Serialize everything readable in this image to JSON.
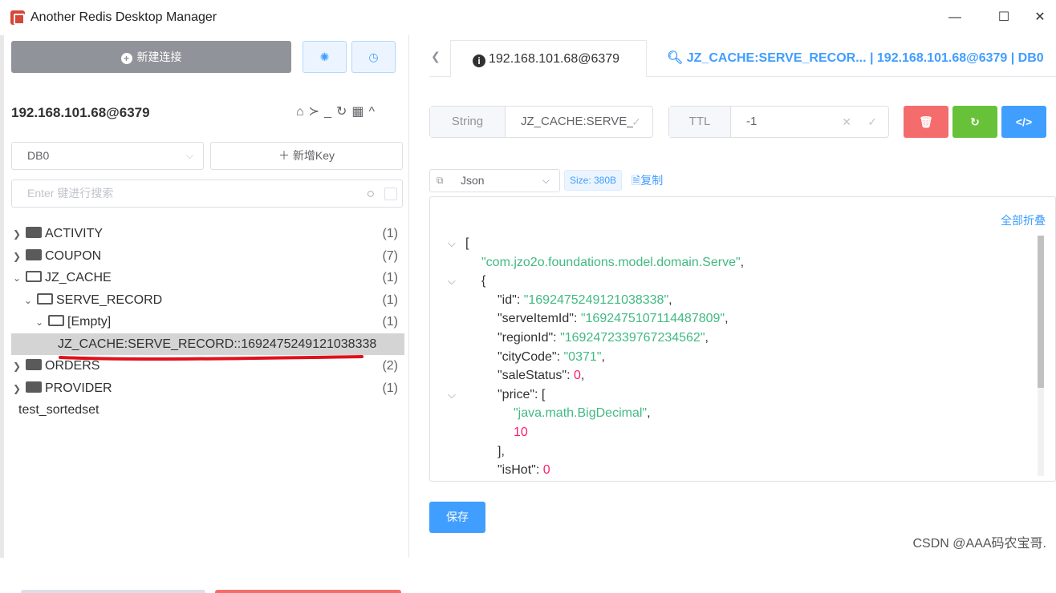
{
  "window": {
    "title": "Another Redis Desktop Manager",
    "minimize": "—",
    "maximize": "☐",
    "close": "✕"
  },
  "sidebar": {
    "new_connection_label": "新建连接",
    "connection_name": "192.168.101.68@6379",
    "tools": [
      "⌂",
      "≻_",
      "↻",
      "▦",
      "^"
    ],
    "db_select": "DB0",
    "add_key_label": "＋ 新增Key",
    "search_placeholder": "Enter 键进行搜索",
    "tree": [
      {
        "label": "ACTIVITY",
        "count": "(1)"
      },
      {
        "label": "COUPON",
        "count": "(7)"
      },
      {
        "label": "JZ_CACHE",
        "count": "(1)"
      },
      {
        "label": "SERVE_RECORD",
        "count": "(1)"
      },
      {
        "label": "[Empty]",
        "count": "(1)"
      },
      {
        "label": "JZ_CACHE:SERVE_RECORD::1692475249121038338",
        "count": ""
      },
      {
        "label": "ORDERS",
        "count": "(2)"
      },
      {
        "label": "PROVIDER",
        "count": "(1)"
      },
      {
        "label": "test_sortedset",
        "count": ""
      }
    ]
  },
  "tabs": {
    "tab1_label": "192.168.101.68@6379",
    "tab2_label": "JZ_CACHE:SERVE_RECOR... | 192.168.101.68@6379 | DB0"
  },
  "key_editor": {
    "type_label": "String",
    "key_value": "JZ_CACHE:SERVE_",
    "ttl_label": "TTL",
    "ttl_value": "-1",
    "format": "Json",
    "size_tag": "Size: 380B",
    "copy_label": "复制",
    "collapse_all": "全部折叠",
    "save_label": "保存"
  },
  "json_lines": [
    {
      "fold": true,
      "indent": 0,
      "html": "["
    },
    {
      "fold": false,
      "indent": 1,
      "html": "<span class='s'>\"com.jzo2o.foundations.model.domain.Serve\"</span>,"
    },
    {
      "fold": true,
      "indent": 1,
      "html": "{"
    },
    {
      "fold": false,
      "indent": 2,
      "html": "\"id\": <span class='s'>\"1692475249121038338\"</span>,"
    },
    {
      "fold": false,
      "indent": 2,
      "html": "\"serveItemId\": <span class='s'>\"1692475107114487809\"</span>,"
    },
    {
      "fold": false,
      "indent": 2,
      "html": "\"regionId\": <span class='s'>\"1692472339767234562\"</span>,"
    },
    {
      "fold": false,
      "indent": 2,
      "html": "\"cityCode\": <span class='s'>\"0371\"</span>,"
    },
    {
      "fold": false,
      "indent": 2,
      "html": "\"saleStatus\": <span class='n'>0</span>,"
    },
    {
      "fold": true,
      "indent": 2,
      "html": "\"price\": ["
    },
    {
      "fold": false,
      "indent": 3,
      "html": "<span class='s'>\"java.math.BigDecimal\"</span>,"
    },
    {
      "fold": false,
      "indent": 3,
      "html": "<span class='n'>10</span>"
    },
    {
      "fold": false,
      "indent": 2,
      "html": "],"
    },
    {
      "fold": false,
      "indent": 2,
      "html": "\"isHot\": <span class='n'>0</span>"
    }
  ],
  "watermark": "CSDN @AAA码农宝哥.",
  "colors": {
    "accent": "#409eff",
    "delete": "#f56c6c",
    "refresh": "#67c23a",
    "string_value": "#42b983",
    "number_value": "#fc1e70"
  }
}
